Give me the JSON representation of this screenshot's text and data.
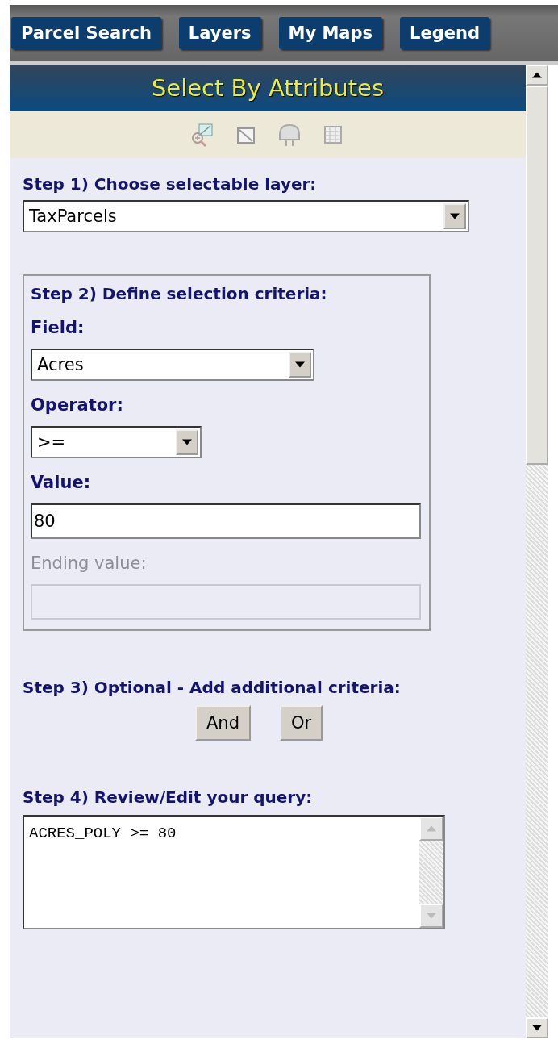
{
  "tabs": [
    {
      "label": "Parcel Search",
      "selected": false
    },
    {
      "label": "Layers",
      "selected": false
    },
    {
      "label": "My Maps",
      "selected": false
    },
    {
      "label": "Legend",
      "selected": false
    }
  ],
  "panel": {
    "title": "Select By Attributes"
  },
  "step1": {
    "label": "Step 1) Choose selectable layer:",
    "layer": "TaxParcels"
  },
  "step2": {
    "label": "Step 2) Define selection criteria:",
    "field_label": "Field:",
    "field": "Acres",
    "operator_label": "Operator:",
    "operator": ">=",
    "value_label": "Value:",
    "value": "80",
    "ending_label": "Ending value:",
    "ending_disabled": true
  },
  "step3": {
    "label": "Step 3) Optional - Add additional criteria:",
    "buttons": [
      "And",
      "Or"
    ]
  },
  "step4": {
    "label": "Step 4) Review/Edit your query:",
    "query": "ACRES_POLY >= 80"
  }
}
